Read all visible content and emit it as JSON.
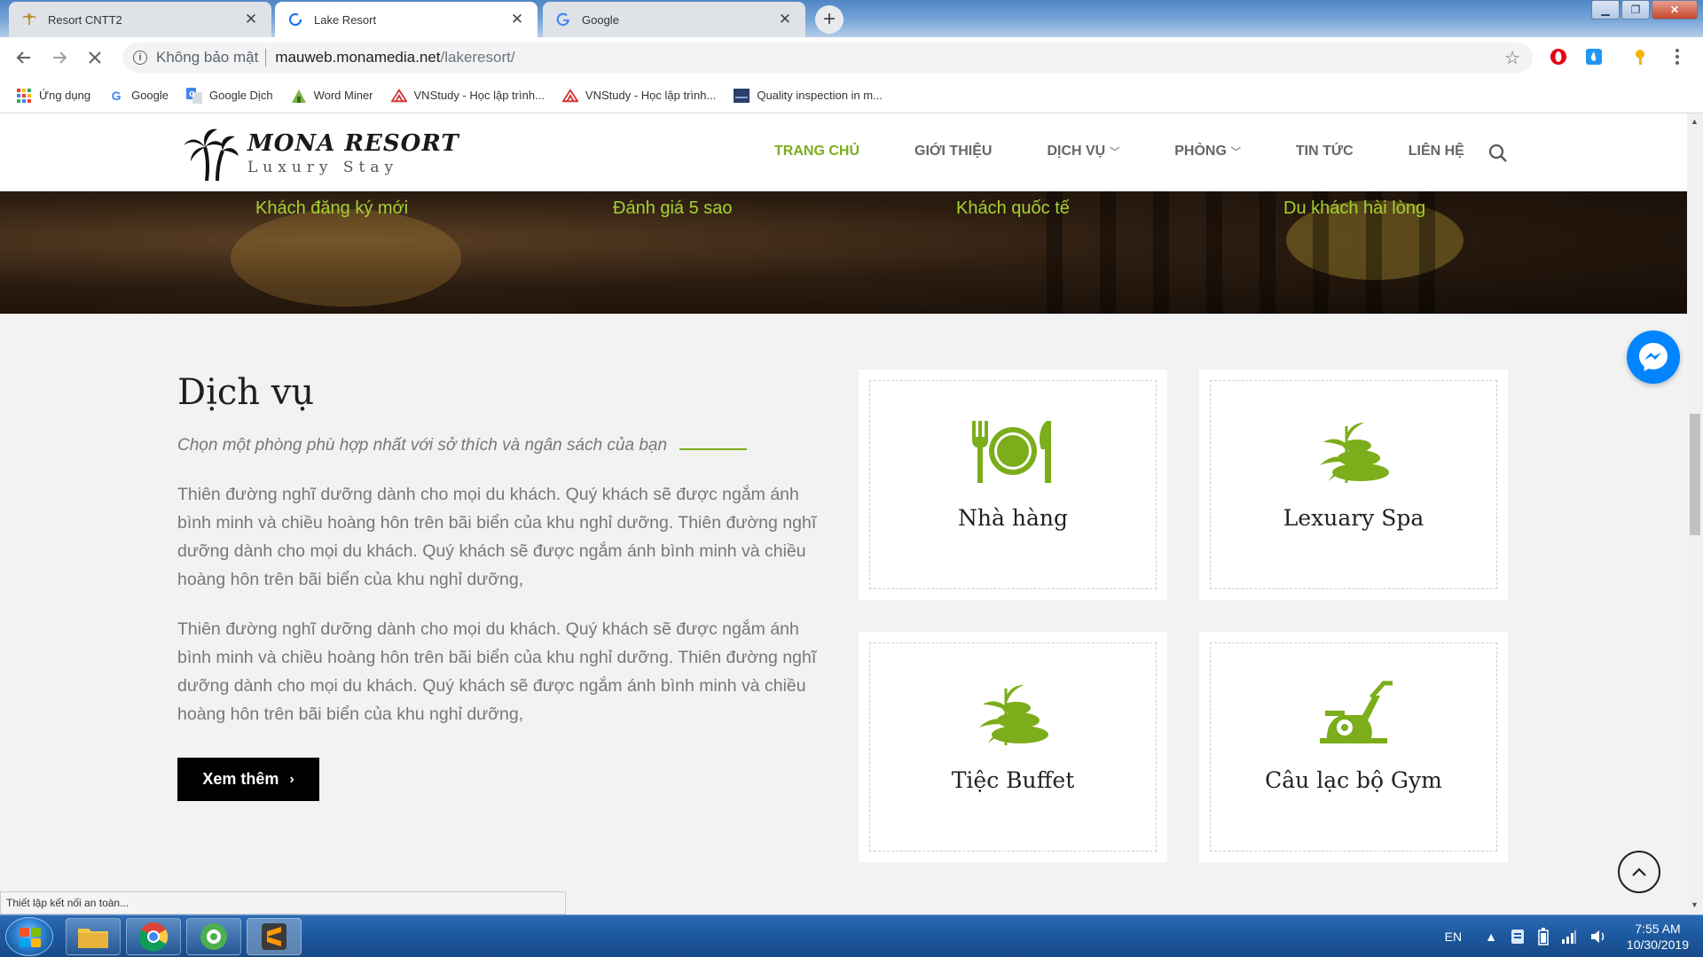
{
  "browser": {
    "tabs": [
      {
        "title": "Resort CNTT2",
        "active": false
      },
      {
        "title": "Lake Resort",
        "active": true
      },
      {
        "title": "Google",
        "active": false
      }
    ],
    "new_tab_label": "+",
    "omnibox": {
      "security_text": "Không bảo mật",
      "url_host": "mauweb.monamedia.net",
      "url_path": "/lakeresort/"
    },
    "bookmarks": [
      {
        "label": "Ứng dụng",
        "icon": "apps-grid-icon"
      },
      {
        "label": "Google",
        "icon": "google-icon"
      },
      {
        "label": "Google Dịch",
        "icon": "google-translate-icon"
      },
      {
        "label": "Word Miner",
        "icon": "word-miner-icon"
      },
      {
        "label": "VNStudy - Học lập trình...",
        "icon": "vnstudy-icon"
      },
      {
        "label": "VNStudy - Học lập trình...",
        "icon": "vnstudy-icon"
      },
      {
        "label": "Quality inspection in m...",
        "icon": "page-icon"
      }
    ],
    "status_text": "Thiết lập kết nối an toàn..."
  },
  "site": {
    "logo": {
      "title": "MONA RESORT",
      "subtitle": "Luxury Stay"
    },
    "nav": [
      {
        "label": "TRANG CHỦ",
        "active": true,
        "has_dropdown": false
      },
      {
        "label": "GIỚI THIỆU",
        "active": false,
        "has_dropdown": false
      },
      {
        "label": "DỊCH VỤ",
        "active": false,
        "has_dropdown": true
      },
      {
        "label": "PHÒNG",
        "active": false,
        "has_dropdown": true
      },
      {
        "label": "TIN TỨC",
        "active": false,
        "has_dropdown": false
      },
      {
        "label": "LIÊN HỆ",
        "active": false,
        "has_dropdown": false
      }
    ],
    "stats": [
      "Khách đăng ký mới",
      "Đánh giá 5 sao",
      "Khách quốc tế",
      "Du khách hài lòng"
    ],
    "services": {
      "title": "Dịch vụ",
      "subtitle": "Chọn một phòng phù hợp nhất với sở thích và ngân sách của bạn",
      "paragraphs": [
        "Thiên đường nghĩ dưỡng dành cho mọi du khách. Quý khách sẽ được ngắm ánh bình minh và chiều hoàng hôn trên bãi biển của khu nghỉ dưỡng. Thiên đường nghĩ dưỡng dành cho mọi du khách. Quý khách sẽ được ngắm ánh bình minh và chiều hoàng hôn trên bãi biển của khu nghỉ dưỡng,",
        "Thiên đường nghĩ dưỡng dành cho mọi du khách. Quý khách sẽ được ngắm ánh bình minh và chiều hoàng hôn trên bãi biển của khu nghỉ dưỡng. Thiên đường nghĩ dưỡng dành cho mọi du khách. Quý khách sẽ được ngắm ánh bình minh và chiều hoàng hôn trên bãi biển của khu nghỉ dưỡng,"
      ],
      "button_label": "Xem thêm",
      "cards": [
        {
          "title": "Nhà hàng",
          "icon": "restaurant-icon"
        },
        {
          "title": "Lexuary Spa",
          "icon": "spa-stones-icon"
        },
        {
          "title": "Tiệc Buffet",
          "icon": "spa-stones-icon"
        },
        {
          "title": "Câu lạc bộ Gym",
          "icon": "exercise-bike-icon"
        }
      ]
    }
  },
  "taskbar": {
    "language": "EN",
    "time": "7:55 AM",
    "date": "10/30/2019"
  },
  "colors": {
    "accent_green": "#7cad1a",
    "stat_green": "#a7d130",
    "messenger_blue": "#0084ff"
  }
}
